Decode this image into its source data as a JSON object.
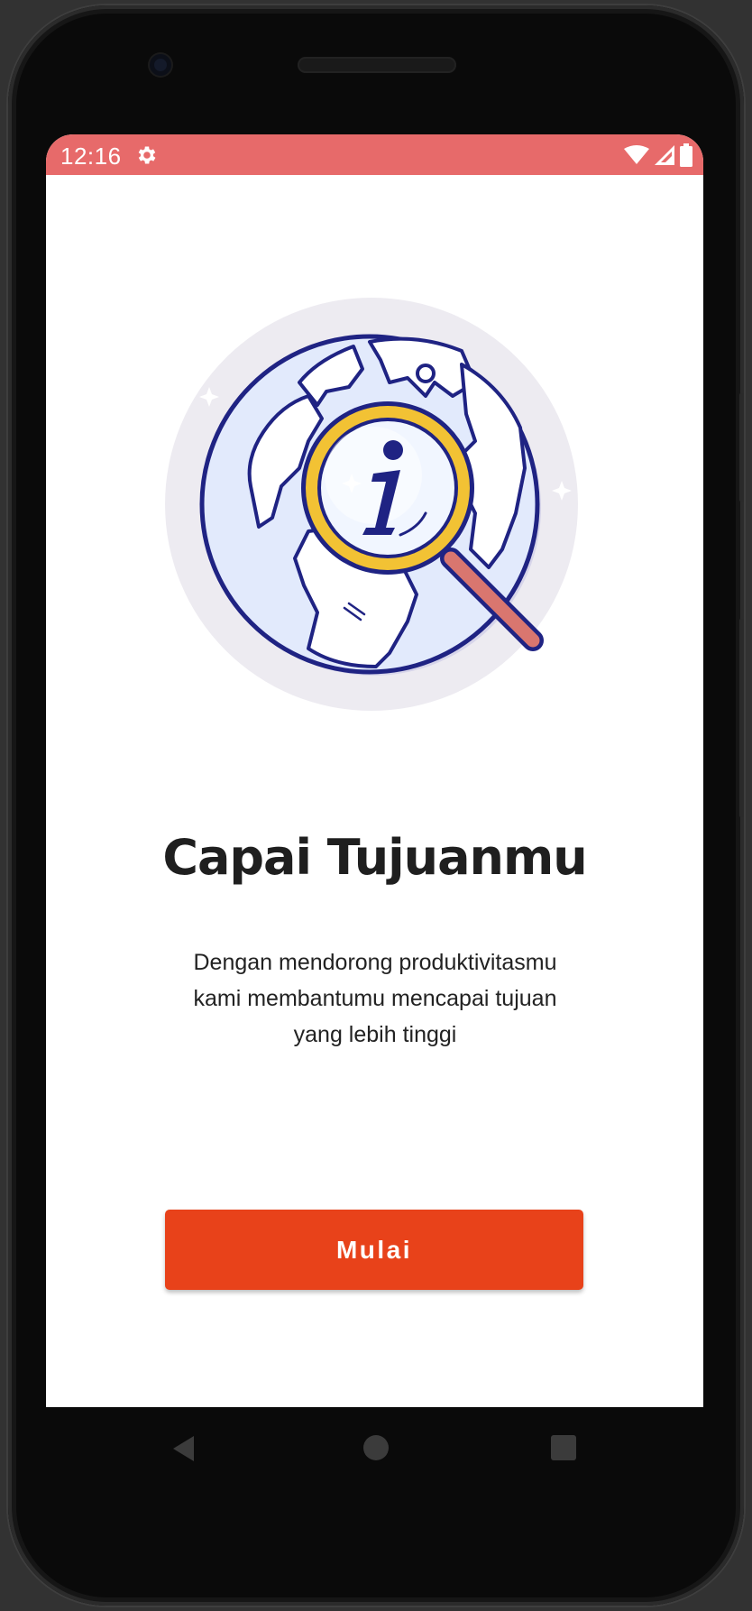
{
  "status_bar": {
    "time": "12:16",
    "background_color": "#e76a6a",
    "icons": [
      "gear-icon",
      "wifi-icon",
      "signal-icon",
      "battery-icon"
    ]
  },
  "onboarding": {
    "illustration": "globe-magnifier-info-illustration",
    "title": "Capai Tujuanmu",
    "description": "Dengan mendorong produktivitasmu kami membantumu mencapai tujuan yang lebih tinggi",
    "button_label": "Mulai",
    "button_color": "#e8421a"
  },
  "nav_bar": {
    "icons": [
      "back-icon",
      "home-icon",
      "recents-icon"
    ]
  }
}
